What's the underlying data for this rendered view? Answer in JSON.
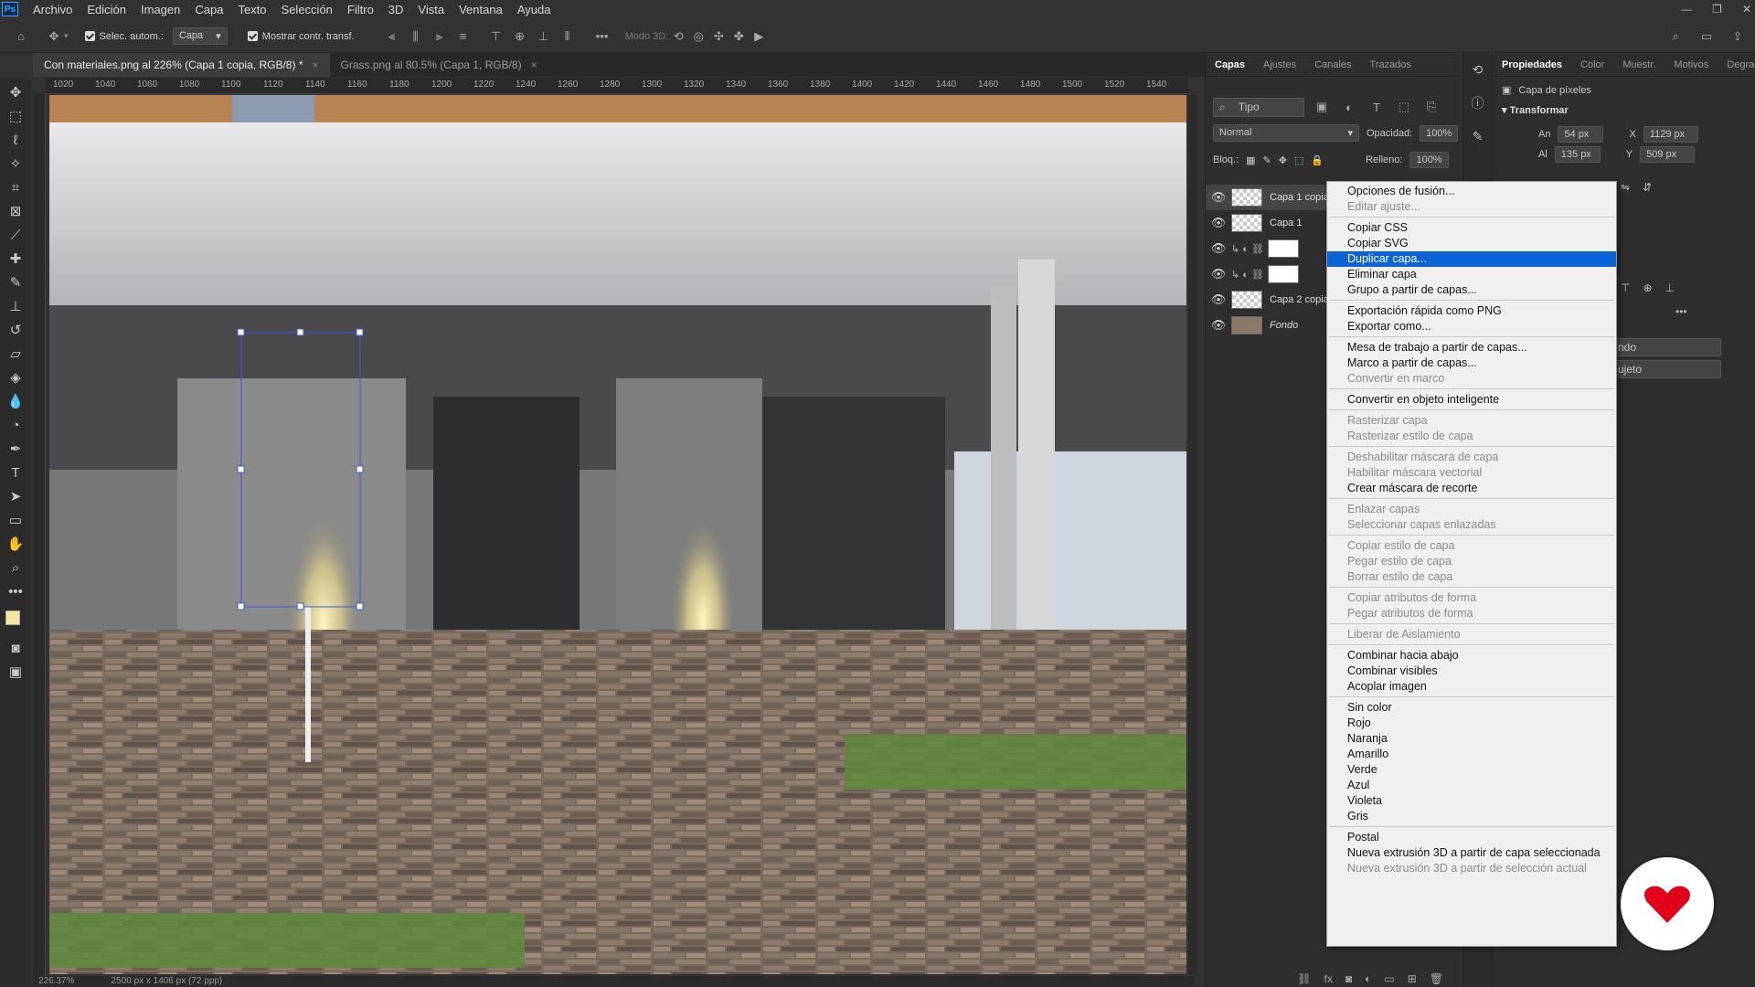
{
  "menubar": {
    "app_icon": "Ps",
    "items": [
      "Archivo",
      "Edición",
      "Imagen",
      "Capa",
      "Texto",
      "Selección",
      "Filtro",
      "3D",
      "Vista",
      "Ventana",
      "Ayuda"
    ]
  },
  "options_bar": {
    "auto_select_label": "Selec. autom.:",
    "auto_select_value": "Capa",
    "show_transform_label": "Mostrar contr. transf.",
    "mode3d_label": "Modo 3D:"
  },
  "doc_tabs": [
    {
      "label": "Con materiales.png al 226% (Capa 1 copia, RGB/8) *"
    },
    {
      "label": "Grass.png al 80.5% (Capa 1, RGB/8)"
    }
  ],
  "ruler_ticks": [
    "1020",
    "1040",
    "1060",
    "1080",
    "1100",
    "1120",
    "1140",
    "1160",
    "1180",
    "1200",
    "1220",
    "1240",
    "1260",
    "1280",
    "1300",
    "1320",
    "1340",
    "1360",
    "1380",
    "1400",
    "1420",
    "1440",
    "1460",
    "1480",
    "1500",
    "1520",
    "1540"
  ],
  "status": {
    "zoom": "226.37%",
    "doc": "2500 px x 1406 px (72 ppp)"
  },
  "layers_panel": {
    "tabs": [
      "Capas",
      "Ajustes",
      "Canales",
      "Trazados"
    ],
    "filter": "Tipo",
    "blend_mode": "Normal",
    "opacity_label": "Opacidad:",
    "opacity_value": "100%",
    "lock_label": "Bloq.:",
    "fill_label": "Relleno:",
    "fill_value": "100%",
    "layers": [
      {
        "name": "Capa 1 copia"
      },
      {
        "name": "Capa 1"
      },
      {
        "name": ""
      },
      {
        "name": ""
      },
      {
        "name": "Capa 2 copia"
      },
      {
        "name": "Fondo"
      }
    ]
  },
  "properties_panel": {
    "tabs": [
      "Propiedades",
      "Color",
      "Muestr.",
      "Motivos",
      "Degrad."
    ],
    "kind": "Capa de píxeles",
    "section": "Transformar",
    "w_label": "An",
    "w_value": "54 px",
    "h_label": "Al",
    "h_value": "135 px",
    "x_label": "X",
    "x_value": "1129 px",
    "y_label": "Y",
    "y_value": "509 px",
    "field1": "ndo",
    "field2": "ujeto"
  },
  "context_menu": {
    "groups": [
      [
        {
          "label": "Opciones de fusión...",
          "enabled": true
        },
        {
          "label": "Editar ajuste...",
          "enabled": false
        }
      ],
      [
        {
          "label": "Copiar CSS",
          "enabled": true
        },
        {
          "label": "Copiar SVG",
          "enabled": true
        },
        {
          "label": "Duplicar capa...",
          "enabled": true,
          "highlighted": true
        },
        {
          "label": "Eliminar capa",
          "enabled": true
        },
        {
          "label": "Grupo a partir de capas...",
          "enabled": true
        }
      ],
      [
        {
          "label": "Exportación rápida como PNG",
          "enabled": true
        },
        {
          "label": "Exportar como...",
          "enabled": true
        }
      ],
      [
        {
          "label": "Mesa de trabajo a partir de capas...",
          "enabled": true
        },
        {
          "label": "Marco a partir de capas...",
          "enabled": true
        },
        {
          "label": "Convertir en marco",
          "enabled": false
        }
      ],
      [
        {
          "label": "Convertir en objeto inteligente",
          "enabled": true
        }
      ],
      [
        {
          "label": "Rasterizar capa",
          "enabled": false
        },
        {
          "label": "Rasterizar estilo de capa",
          "enabled": false
        }
      ],
      [
        {
          "label": "Deshabilitar máscara de capa",
          "enabled": false
        },
        {
          "label": "Habilitar máscara vectorial",
          "enabled": false
        },
        {
          "label": "Crear máscara de recorte",
          "enabled": true
        }
      ],
      [
        {
          "label": "Enlazar capas",
          "enabled": false
        },
        {
          "label": "Seleccionar capas enlazadas",
          "enabled": false
        }
      ],
      [
        {
          "label": "Copiar estilo de capa",
          "enabled": false
        },
        {
          "label": "Pegar estilo de capa",
          "enabled": false
        },
        {
          "label": "Borrar estilo de capa",
          "enabled": false
        }
      ],
      [
        {
          "label": "Copiar atributos de forma",
          "enabled": false
        },
        {
          "label": "Pegar atributos de forma",
          "enabled": false
        }
      ],
      [
        {
          "label": "Liberar de Aislamiento",
          "enabled": false
        }
      ],
      [
        {
          "label": "Combinar hacia abajo",
          "enabled": true
        },
        {
          "label": "Combinar visibles",
          "enabled": true
        },
        {
          "label": "Acoplar imagen",
          "enabled": true
        }
      ],
      [
        {
          "label": "Sin color",
          "enabled": true
        },
        {
          "label": "Rojo",
          "enabled": true
        },
        {
          "label": "Naranja",
          "enabled": true
        },
        {
          "label": "Amarillo",
          "enabled": true
        },
        {
          "label": "Verde",
          "enabled": true
        },
        {
          "label": "Azul",
          "enabled": true
        },
        {
          "label": "Violeta",
          "enabled": true
        },
        {
          "label": "Gris",
          "enabled": true
        }
      ],
      [
        {
          "label": "Postal",
          "enabled": true
        },
        {
          "label": "Nueva extrusión 3D a partir de capa seleccionada",
          "enabled": true
        },
        {
          "label": "Nueva extrusión 3D a partir de selección actual",
          "enabled": false
        }
      ]
    ]
  },
  "colors": {
    "highlight": "#0a64d8",
    "badge_red": "#e3001b",
    "foreground_swatch": "#f5e6a3"
  }
}
